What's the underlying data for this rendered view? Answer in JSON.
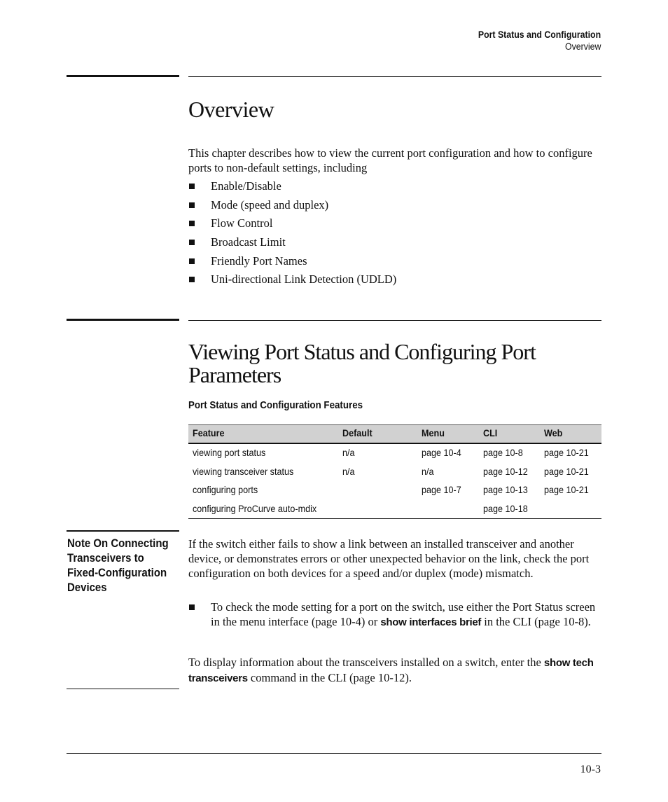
{
  "header": {
    "chapter_title": "Port Status and Configuration",
    "section_title": "Overview"
  },
  "overview": {
    "heading": "Overview",
    "intro": "This chapter describes how to view the current port configuration and how to configure ports to non-default settings, including",
    "bullets": [
      "Enable/Disable",
      "Mode (speed and duplex)",
      "Flow Control",
      "Broadcast Limit",
      "Friendly Port Names",
      "Uni-directional Link Detection (UDLD)"
    ]
  },
  "viewing": {
    "heading": "Viewing Port Status and Configuring Port Parameters",
    "table_caption": "Port Status and Configuration Features",
    "table": {
      "headers": [
        "Feature",
        "Default",
        "Menu",
        "CLI",
        "Web"
      ],
      "rows": [
        [
          "viewing port status",
          "n/a",
          "page 10-4",
          "page 10-8",
          "page 10-21"
        ],
        [
          "viewing transceiver status",
          "n/a",
          "n/a",
          "page 10-12",
          "page 10-21"
        ],
        [
          "configuring ports",
          "",
          "page 10-7",
          "page 10-13",
          "page 10-21"
        ],
        [
          "configuring ProCurve auto-mdix",
          "",
          "",
          "page 10-18",
          ""
        ]
      ]
    }
  },
  "note": {
    "heading": "Note On Connecting Transceivers to Fixed-Configuration Devices",
    "paragraph": "If the switch either fails to show a link between an installed transceiver and another device, or demonstrates errors or other unexpected behavior on the link, check the port configuration on both devices for a speed and/or duplex (mode) mismatch.",
    "bullet_pre": "To check the mode setting for a port on the switch, use either the Port Status screen in the menu interface (page 10-4) or ",
    "bullet_cmd": "show interfaces brief",
    "bullet_post": " in the CLI (page 10-8).",
    "para2_pre": "To display information about the transceivers installed on a switch, enter the ",
    "para2_cmd": "show tech transceivers",
    "para2_post": " command in the CLI (page 10-12)."
  },
  "footer": {
    "page_number": "10-3"
  }
}
